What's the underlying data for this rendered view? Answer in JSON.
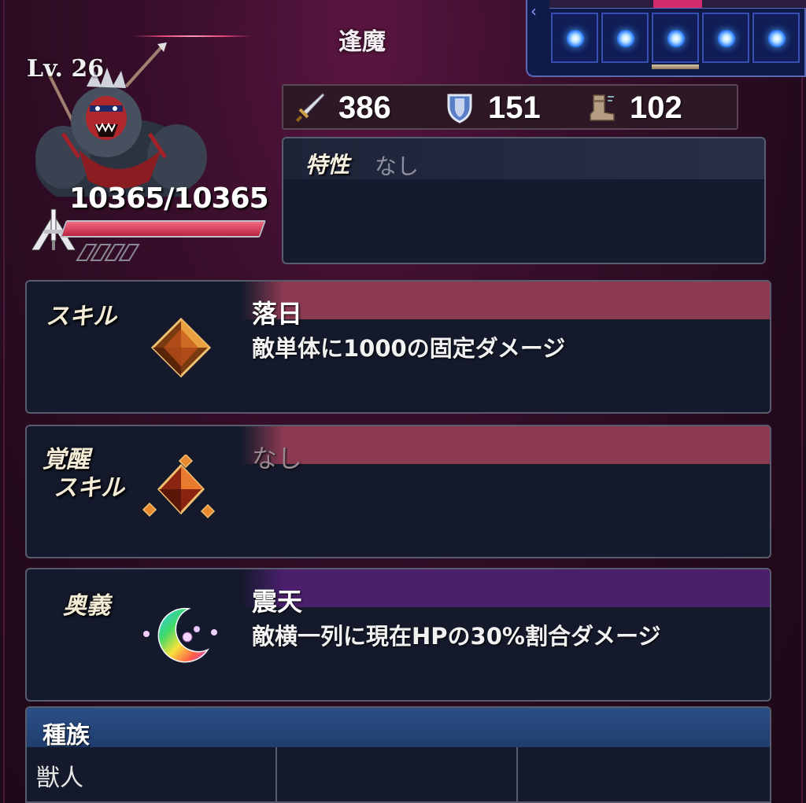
{
  "header": {
    "title": "逢魔"
  },
  "orbs": {
    "count": 5
  },
  "monster": {
    "level": "Lv. 26",
    "hp_text": "10365/10365",
    "hp_current": 10365,
    "hp_max": 10365
  },
  "stats": {
    "attack": "386",
    "defense": "151",
    "speed": "102",
    "attack_icon": "sword-icon",
    "defense_icon": "shield-icon",
    "speed_icon": "boot-icon"
  },
  "trait": {
    "label": "特性",
    "value": "なし"
  },
  "skill": {
    "label": "スキル",
    "name": "落日",
    "description": "敵単体に1000の固定ダメージ",
    "icon": "orange-crystal-icon"
  },
  "awakened_skill": {
    "label_line1": "覚醒",
    "label_line2": "スキル",
    "name": "なし",
    "icon": "awakened-crystal-icon"
  },
  "ultimate": {
    "label": "奥義",
    "name": "震天",
    "description": "敵横一列に現在HPの30%割合ダメージ",
    "icon": "rainbow-moon-icon"
  },
  "race": {
    "header": "種族",
    "values": [
      "獣人",
      "",
      ""
    ]
  },
  "colors": {
    "skill_band": "#8b3a52",
    "ultimate_band": "#4b1f6c",
    "race_header": "#2b4f86",
    "hp_fill": "#d8324f"
  }
}
